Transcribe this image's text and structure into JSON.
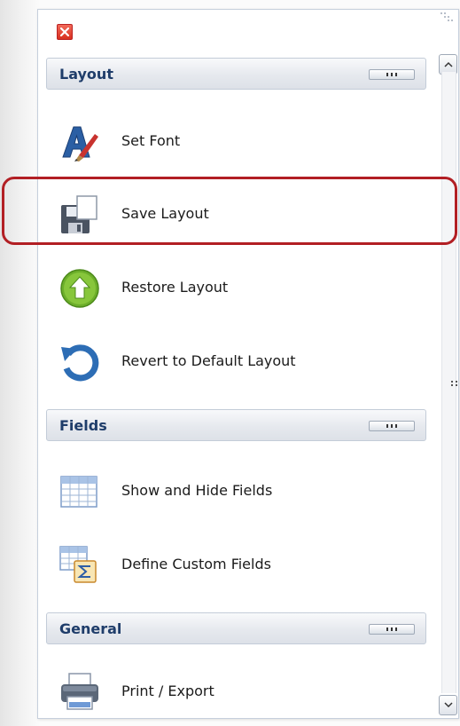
{
  "panel": {
    "close_icon": "close-icon",
    "groups": [
      {
        "title": "Layout",
        "items": [
          {
            "label": "Set Font",
            "icon": "font-icon"
          },
          {
            "label": "Save Layout",
            "icon": "save-icon"
          },
          {
            "label": "Restore Layout",
            "icon": "restore-icon"
          },
          {
            "label": "Revert to Default Layout",
            "icon": "revert-icon"
          }
        ]
      },
      {
        "title": "Fields",
        "items": [
          {
            "label": "Show and Hide Fields",
            "icon": "table-icon"
          },
          {
            "label": "Define Custom Fields",
            "icon": "custom-field-icon"
          }
        ]
      },
      {
        "title": "General",
        "items": [
          {
            "label": "Print / Export",
            "icon": "printer-icon"
          }
        ]
      }
    ]
  },
  "colors": {
    "group_title": "#1f3d6a",
    "highlight_border": "#b21f24",
    "close_button": "#d8301f"
  }
}
